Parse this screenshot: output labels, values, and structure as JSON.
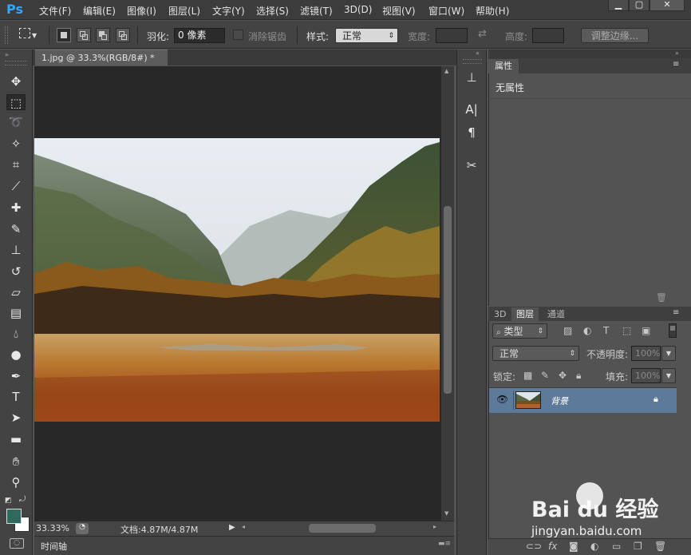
{
  "app": {
    "logo": "Ps"
  },
  "menu": [
    "文件(F)",
    "编辑(E)",
    "图像(I)",
    "图层(L)",
    "文字(Y)",
    "选择(S)",
    "滤镜(T)",
    "3D(D)",
    "视图(V)",
    "窗口(W)",
    "帮助(H)"
  ],
  "window_controls": {
    "minimize": "▁",
    "restore": "▢",
    "close": "✕"
  },
  "options": {
    "feather_label": "羽化:",
    "feather_value": "0 像素",
    "antialias_label": "消除锯齿",
    "style_label": "样式:",
    "style_value": "正常",
    "width_label": "宽度:",
    "height_label": "高度:",
    "refine_edge_button": "调整边缘..."
  },
  "document": {
    "tab_title": "1.jpg @ 33.3%(RGB/8#) *",
    "tab_close": "×",
    "zoom": "33.33%",
    "doc_info": "文档:4.87M/4.87M"
  },
  "timeline_label": "时间轴",
  "properties": {
    "tab": "属性",
    "content": "无属性"
  },
  "layers_panel": {
    "tabs": [
      "3D",
      "图层",
      "通道"
    ],
    "active_tab": "图层",
    "filter_kind": "类型",
    "blend_mode": "正常",
    "opacity_label": "不透明度:",
    "opacity_value": "100%",
    "lock_label": "锁定:",
    "fill_label": "填充:",
    "fill_value": "100%",
    "layers": [
      {
        "name": "背景",
        "locked": true,
        "visible": true
      }
    ]
  },
  "colors": {
    "foreground": "#2e6b5e",
    "background": "#ffffff",
    "selected_layer": "#5d7a9b"
  },
  "watermark": {
    "brand": "Bai du 经验",
    "url": "jingyan.baidu.com"
  }
}
